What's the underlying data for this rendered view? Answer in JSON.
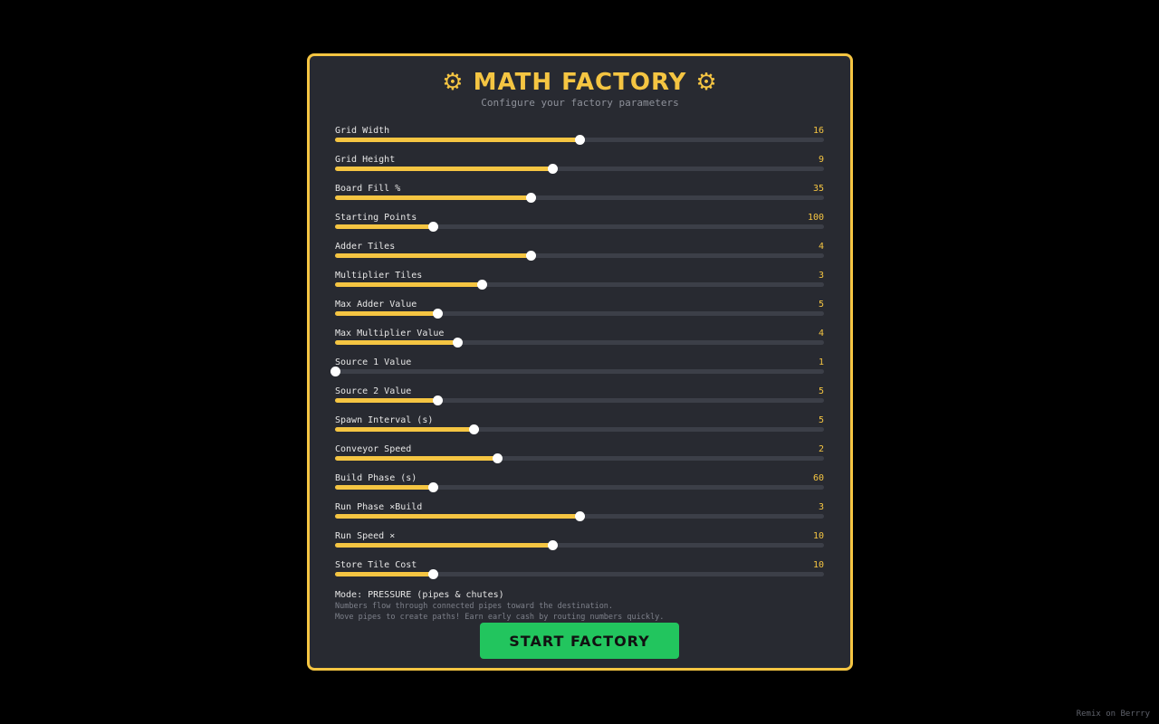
{
  "header": {
    "title": "⚙ MATH FACTORY ⚙",
    "subtitle": "Configure your factory parameters"
  },
  "sliders": [
    {
      "label": "Grid Width",
      "value": "16",
      "fraction": 0.5
    },
    {
      "label": "Grid Height",
      "value": "9",
      "fraction": 0.445
    },
    {
      "label": "Board Fill %",
      "value": "35",
      "fraction": 0.4
    },
    {
      "label": "Starting Points",
      "value": "100",
      "fraction": 0.2
    },
    {
      "label": "Adder Tiles",
      "value": "4",
      "fraction": 0.4
    },
    {
      "label": "Multiplier Tiles",
      "value": "3",
      "fraction": 0.3
    },
    {
      "label": "Max Adder Value",
      "value": "5",
      "fraction": 0.21
    },
    {
      "label": "Max Multiplier Value",
      "value": "4",
      "fraction": 0.25
    },
    {
      "label": "Source 1 Value",
      "value": "1",
      "fraction": 0.0
    },
    {
      "label": "Source 2 Value",
      "value": "5",
      "fraction": 0.21
    },
    {
      "label": "Spawn Interval (s)",
      "value": "5",
      "fraction": 0.285
    },
    {
      "label": "Conveyor Speed",
      "value": "2",
      "fraction": 0.333
    },
    {
      "label": "Build Phase (s)",
      "value": "60",
      "fraction": 0.2
    },
    {
      "label": "Run Phase ×Build",
      "value": "3",
      "fraction": 0.5
    },
    {
      "label": "Run Speed ×",
      "value": "10",
      "fraction": 0.445
    },
    {
      "label": "Store Tile Cost",
      "value": "10",
      "fraction": 0.2
    }
  ],
  "mode": {
    "label": "Mode: PRESSURE (pipes & chutes)",
    "description_lines": [
      "Numbers flow through connected pipes toward the destination.",
      "Move pipes to create paths! Earn early cash by routing numbers quickly."
    ]
  },
  "start_button": {
    "label": "START FACTORY"
  },
  "footer": {
    "link": "Remix on Berrry"
  },
  "colors": {
    "accent": "#f5c542",
    "panel": "#282a31",
    "button": "#22c55e"
  }
}
